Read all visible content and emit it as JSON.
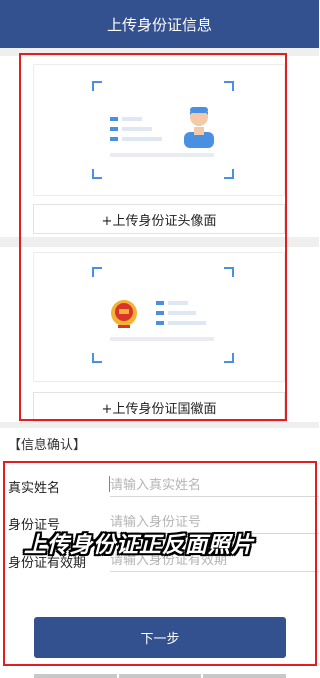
{
  "header": {
    "title": "上传身份证信息"
  },
  "cards": [
    {
      "upload_label": "+上传身份证头像面"
    },
    {
      "upload_label": "+上传身份证国徽面"
    }
  ],
  "info": {
    "section_title": "【信息确认】",
    "fields": [
      {
        "label": "真实姓名",
        "value": "",
        "placeholder": "请输入真实姓名"
      },
      {
        "label": "身份证号",
        "value": "",
        "placeholder": "请输入身份证号"
      },
      {
        "label": "身份证有效期",
        "value": "",
        "placeholder": "请输入身份证有效期"
      }
    ]
  },
  "overlay_caption": "上传身份证正反面照片",
  "next_button": {
    "label": "下一步"
  },
  "colors": {
    "primary": "#33508f",
    "highlight": "#e41e1e",
    "icon_blue": "#4a90e2",
    "emblem_red": "#d9342b"
  }
}
